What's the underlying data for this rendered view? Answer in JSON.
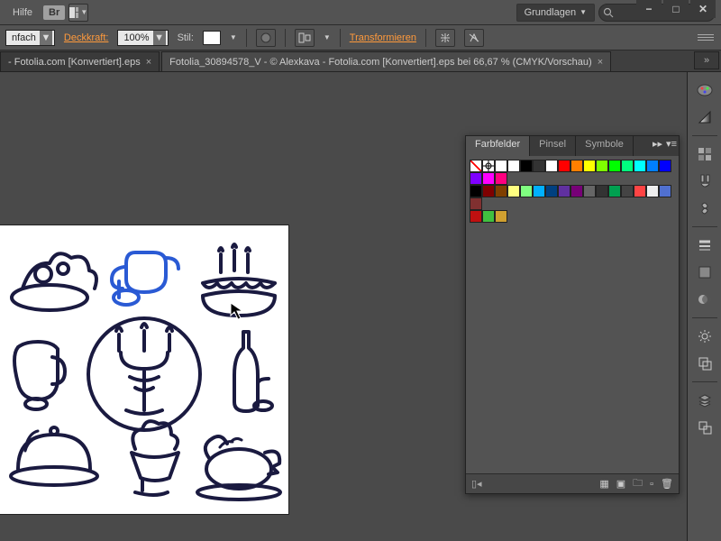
{
  "menubar": {
    "help": "Hilfe",
    "bridge": "Br",
    "workspace": "Grundlagen"
  },
  "window_controls": {
    "min": "−",
    "max": "□",
    "close": "✕"
  },
  "optionsbar": {
    "mode": "nfach",
    "opacity_label": "Deckkraft:",
    "opacity_value": "100%",
    "style_label": "Stil:",
    "transform": "Transformieren"
  },
  "tabs": {
    "inactive": " - Fotolia.com [Konvertiert].eps",
    "active": "Fotolia_30894578_V - © Alexkava - Fotolia.com [Konvertiert].eps bei 66,67 % (CMYK/Vorschau)"
  },
  "panel": {
    "tab_swatches": "Farbfelder",
    "tab_brushes": "Pinsel",
    "tab_symbols": "Symbole",
    "swatches_row1": [
      "#ffffff",
      "#ffffff",
      "#000000",
      "#333333",
      "#ffffff",
      "#ff0000",
      "#ff7f00",
      "#ffff00",
      "#7fff00",
      "#00ff00",
      "#00ff7f",
      "#00ffff",
      "#007fff",
      "#0000ff",
      "#7f00ff",
      "#ff00ff",
      "#ff007f"
    ],
    "swatches_row2": [
      "#000000",
      "#7f0000",
      "#7f3f00",
      "#ffff80",
      "#80ff80",
      "#00b0ff",
      "#004080",
      "#6030a0",
      "#770077",
      "#666666",
      "#333333",
      "#00a050",
      "#444444",
      "#ff4444",
      "#eeeeee",
      "#5070d0",
      "#803030"
    ],
    "swatches_row3": [
      "#c01010",
      "#40c040",
      "#d0a030"
    ]
  },
  "rail_icons": [
    "color",
    "gradient",
    "grid",
    "brush",
    "symbol",
    "stroke",
    "appearance",
    "transparency",
    "sep",
    "align",
    "pathfinder",
    "sep",
    "layers",
    "artboards"
  ],
  "artwork": {
    "selected_color": "#2a5ad4",
    "stroke_color": "#111133"
  }
}
